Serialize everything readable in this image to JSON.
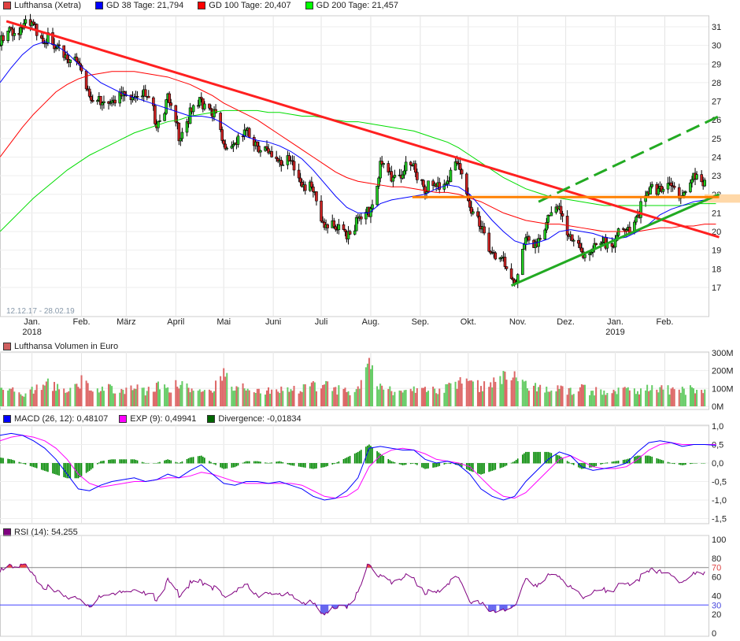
{
  "legend": {
    "price": {
      "label": "Lufthansa (Xetra)",
      "color": "#e04040"
    },
    "gd38": {
      "label": "GD 38 Tage: 21,794",
      "color": "#0000ff"
    },
    "gd100": {
      "label": "GD 100 Tage: 20,407",
      "color": "#ff0000"
    },
    "gd200": {
      "label": "GD 200 Tage: 21,457",
      "color": "#00dd00"
    },
    "volume": {
      "label": "Lufthansa Volumen in Euro",
      "color": "#d06060"
    },
    "macd": {
      "label": "MACD (26, 12): 0,48107",
      "color": "#0000ff"
    },
    "exp": {
      "label": "EXP (9): 0,49941",
      "color": "#ff00ff"
    },
    "divergence": {
      "label": "Divergence: -0,01834",
      "color": "#006600"
    },
    "rsi": {
      "label": "RSI (14): 54,255",
      "color": "#800080"
    }
  },
  "date_range": "12.12.17 - 28.02.19",
  "chart_data": [
    {
      "type": "candlestick",
      "title": "Lufthansa (Xetra)",
      "ylim": [
        16,
        32
      ],
      "yticks": [
        "17",
        "18",
        "19",
        "20",
        "21",
        "22",
        "23",
        "24",
        "25",
        "26",
        "27",
        "28",
        "29",
        "30",
        "31"
      ],
      "xticks": [
        {
          "label": "Jan.",
          "sub": "2018",
          "day": 20
        },
        {
          "label": "Feb.",
          "day": 51
        },
        {
          "label": "März",
          "day": 79
        },
        {
          "label": "April",
          "day": 110
        },
        {
          "label": "Mai",
          "day": 140
        },
        {
          "label": "Juni",
          "day": 171
        },
        {
          "label": "Juli",
          "day": 201
        },
        {
          "label": "Aug.",
          "day": 232
        },
        {
          "label": "Sep.",
          "day": 263
        },
        {
          "label": "Okt.",
          "day": 293
        },
        {
          "label": "Nov.",
          "day": 324
        },
        {
          "label": "Dez.",
          "day": 354
        },
        {
          "label": "Jan.",
          "sub": "2019",
          "day": 385
        },
        {
          "label": "Feb.",
          "day": 416
        }
      ],
      "weekly_close": [
        30.0,
        30.8,
        31.0,
        30.9,
        30.5,
        29.6,
        29.5,
        29.0,
        27.5,
        26.8,
        27.3,
        27.2,
        27.6,
        27.2,
        26.0,
        27.0,
        25.3,
        26.2,
        27.0,
        26.6,
        24.5,
        24.8,
        25.2,
        24.8,
        24.0,
        24.0,
        23.5,
        22.8,
        22.0,
        20.5,
        20.0,
        20.0,
        20.5,
        21.0,
        23.5,
        23.0,
        23.2,
        23.5,
        22.5,
        22.3,
        23.0,
        23.5,
        21.5,
        20.0,
        19.0,
        18.2,
        17.3,
        19.3,
        19.5,
        20.5,
        21.5,
        19.5,
        19.0,
        18.9,
        19.3,
        19.6,
        20.0,
        21.0,
        22.0,
        22.5,
        22.3,
        22.0,
        22.8,
        22.8,
        22.9
      ],
      "gd38_weekly": [
        28.0,
        28.8,
        29.5,
        30.0,
        30.2,
        30.0,
        29.6,
        29.0,
        28.5,
        28.0,
        27.7,
        27.4,
        27.2,
        27.0,
        26.8,
        26.6,
        26.4,
        26.2,
        26.2,
        26.1,
        25.8,
        25.4,
        25.1,
        24.9,
        24.8,
        24.6,
        24.3,
        23.9,
        23.3,
        22.6,
        21.9,
        21.3,
        21.0,
        21.0,
        21.5,
        21.7,
        21.8,
        21.9,
        22.0,
        22.3,
        22.5,
        22.4,
        22.0,
        21.3,
        20.6,
        20.0,
        19.5,
        19.3,
        19.4,
        19.6,
        20.0,
        20.1,
        20.0,
        19.9,
        19.7,
        19.6,
        19.7,
        20.0,
        20.4,
        20.9,
        21.2,
        21.4,
        21.6,
        21.7,
        21.8
      ],
      "gd100_weekly": [
        24.0,
        24.8,
        25.6,
        26.3,
        26.9,
        27.5,
        27.9,
        28.2,
        28.4,
        28.5,
        28.6,
        28.6,
        28.6,
        28.5,
        28.4,
        28.3,
        28.1,
        27.9,
        27.6,
        27.3,
        26.9,
        26.6,
        26.3,
        26.0,
        25.6,
        25.2,
        24.8,
        24.4,
        24.0,
        23.6,
        23.2,
        22.9,
        22.7,
        22.6,
        22.5,
        22.4,
        22.4,
        22.3,
        22.2,
        22.1,
        22.1,
        22.0,
        21.8,
        21.6,
        21.3,
        21.0,
        20.8,
        20.6,
        20.5,
        20.4,
        20.4,
        20.3,
        20.2,
        20.1,
        20.0,
        20.0,
        20.0,
        20.0,
        20.1,
        20.2,
        20.2,
        20.3,
        20.3,
        20.4,
        20.4
      ],
      "gd200_weekly": [
        20.0,
        20.6,
        21.2,
        21.8,
        22.3,
        22.8,
        23.3,
        23.7,
        24.1,
        24.4,
        24.7,
        25.0,
        25.3,
        25.5,
        25.7,
        25.9,
        26.0,
        26.2,
        26.3,
        26.4,
        26.5,
        26.5,
        26.5,
        26.5,
        26.4,
        26.4,
        26.3,
        26.2,
        26.2,
        26.1,
        26.0,
        25.9,
        25.9,
        25.8,
        25.7,
        25.6,
        25.5,
        25.4,
        25.2,
        25.0,
        24.8,
        24.5,
        24.1,
        23.7,
        23.3,
        22.9,
        22.6,
        22.3,
        22.1,
        21.9,
        21.8,
        21.7,
        21.6,
        21.5,
        21.4,
        21.4,
        21.4,
        21.4,
        21.4,
        21.4,
        21.4,
        21.4,
        21.5,
        21.5,
        21.5
      ],
      "trendlines": [
        {
          "name": "resistance-red",
          "color": "#ff2020",
          "from": [
            4,
            31.3
          ],
          "to": [
            450,
            19.7
          ]
        },
        {
          "name": "channel-upper-green-dashed",
          "color": "#22aa22",
          "from": [
            337,
            21.6
          ],
          "to": [
            450,
            26.2
          ]
        },
        {
          "name": "channel-lower-green",
          "color": "#22aa22",
          "from": [
            320,
            17.1
          ],
          "to": [
            450,
            22.0
          ]
        },
        {
          "name": "horizontal-orange",
          "color": "#ff8000",
          "from": [
            258,
            21.85
          ],
          "to": [
            450,
            21.85
          ]
        }
      ]
    },
    {
      "type": "bar",
      "title": "Lufthansa Volumen in Euro",
      "yticks": [
        "0M",
        "100M",
        "200M",
        "300M"
      ],
      "ylim": [
        0,
        300
      ],
      "weekly_volume_m": [
        80,
        90,
        70,
        95,
        130,
        110,
        90,
        140,
        120,
        100,
        95,
        90,
        100,
        85,
        110,
        95,
        120,
        100,
        90,
        85,
        180,
        90,
        110,
        80,
        85,
        90,
        95,
        100,
        110,
        120,
        95,
        85,
        90,
        230,
        100,
        85,
        80,
        95,
        110,
        90,
        100,
        130,
        120,
        110,
        120,
        180,
        160,
        110,
        100,
        95,
        90,
        90,
        100,
        85,
        80,
        90,
        95,
        90,
        100,
        95,
        90,
        85,
        100,
        100,
        95
      ]
    },
    {
      "type": "line",
      "title": "MACD",
      "yticks": [
        "1,0",
        "0,5",
        "0,0",
        "-0,5",
        "-1,0",
        "-1,5"
      ],
      "ylim": [
        -1.5,
        1.0
      ],
      "macd_weekly": [
        0.75,
        0.8,
        0.75,
        0.6,
        0.4,
        0.1,
        -0.3,
        -0.7,
        -0.75,
        -0.6,
        -0.5,
        -0.45,
        -0.4,
        -0.5,
        -0.45,
        -0.3,
        -0.4,
        -0.2,
        -0.05,
        -0.3,
        -0.55,
        -0.6,
        -0.5,
        -0.5,
        -0.55,
        -0.5,
        -0.6,
        -0.7,
        -0.9,
        -1.0,
        -0.95,
        -0.75,
        -0.4,
        0.4,
        0.45,
        0.4,
        0.35,
        0.35,
        0.1,
        0.0,
        0.05,
        -0.05,
        -0.3,
        -0.7,
        -0.9,
        -1.0,
        -0.9,
        -0.5,
        -0.2,
        0.1,
        0.3,
        0.2,
        -0.1,
        -0.2,
        -0.15,
        -0.1,
        0.0,
        0.3,
        0.55,
        0.6,
        0.55,
        0.45,
        0.5,
        0.5,
        0.48
      ],
      "exp_weekly": [
        0.6,
        0.7,
        0.75,
        0.7,
        0.6,
        0.4,
        0.1,
        -0.3,
        -0.55,
        -0.65,
        -0.6,
        -0.55,
        -0.5,
        -0.5,
        -0.45,
        -0.4,
        -0.4,
        -0.35,
        -0.25,
        -0.3,
        -0.4,
        -0.5,
        -0.55,
        -0.55,
        -0.55,
        -0.55,
        -0.55,
        -0.6,
        -0.75,
        -0.9,
        -0.95,
        -0.9,
        -0.7,
        -0.1,
        0.2,
        0.35,
        0.4,
        0.35,
        0.25,
        0.1,
        0.05,
        0.0,
        -0.1,
        -0.4,
        -0.7,
        -0.9,
        -0.95,
        -0.8,
        -0.5,
        -0.2,
        0.1,
        0.2,
        0.05,
        -0.1,
        -0.15,
        -0.15,
        -0.1,
        0.1,
        0.35,
        0.5,
        0.55,
        0.5,
        0.5,
        0.5,
        0.5
      ]
    },
    {
      "type": "line",
      "title": "RSI (14)",
      "yticks": [
        "0",
        "20",
        "30",
        "40",
        "60",
        "70",
        "80",
        "100"
      ],
      "ylim": [
        0,
        100
      ],
      "levels": [
        30,
        70
      ],
      "rsi_weekly": [
        65,
        72,
        74,
        60,
        50,
        42,
        40,
        36,
        30,
        38,
        45,
        42,
        50,
        40,
        38,
        55,
        42,
        52,
        55,
        50,
        38,
        45,
        50,
        42,
        40,
        44,
        38,
        35,
        30,
        22,
        25,
        30,
        42,
        75,
        60,
        55,
        60,
        58,
        45,
        42,
        55,
        58,
        35,
        30,
        25,
        22,
        30,
        55,
        52,
        60,
        62,
        48,
        40,
        42,
        45,
        48,
        52,
        58,
        65,
        68,
        60,
        55,
        62,
        66,
        54
      ]
    }
  ]
}
